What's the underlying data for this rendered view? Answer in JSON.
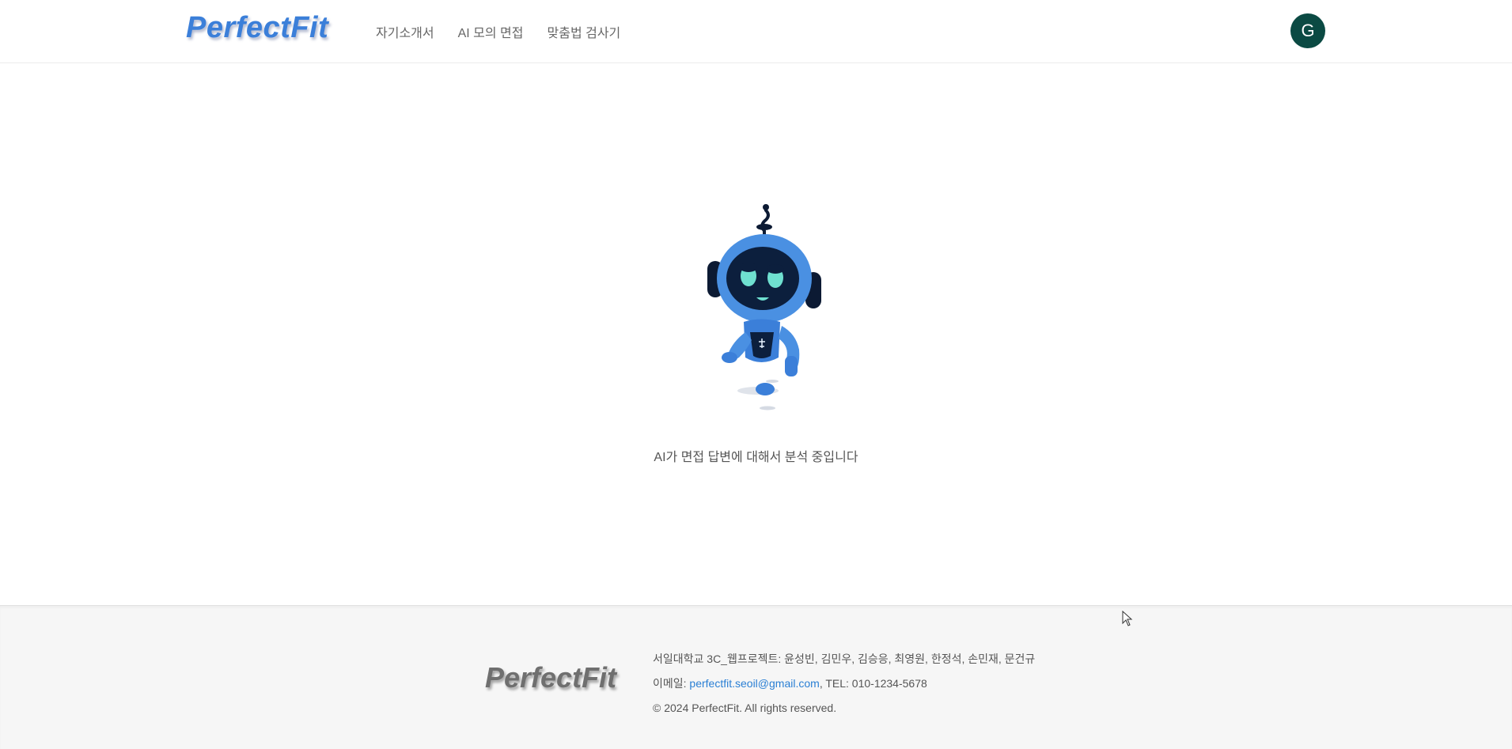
{
  "header": {
    "logo": "PerfectFit",
    "nav": [
      {
        "label": "자기소개서"
      },
      {
        "label": "AI 모의 면접"
      },
      {
        "label": "맞춤법 검사기"
      }
    ],
    "avatar_initial": "G"
  },
  "main": {
    "status_text": "AI가 면접 답변에 대해서 분석 중입니다",
    "illustration": "robot-mascot"
  },
  "footer": {
    "logo": "PerfectFit",
    "project_line": "서일대학교 3C_웹프로젝트: 윤성빈, 김민우, 김승응, 최영원, 한정석, 손민재, 문건규",
    "email_label": "이메일: ",
    "email": "perfectfit.seoil@gmail.com",
    "tel": ", TEL: 010-1234-5678",
    "copyright": "© 2024 PerfectFit. All rights reserved."
  },
  "colors": {
    "logo_blue": "#3b7fd9",
    "avatar_bg": "#0b4a43",
    "link_blue": "#2a7fd4",
    "footer_bg": "#f6f6f6"
  }
}
